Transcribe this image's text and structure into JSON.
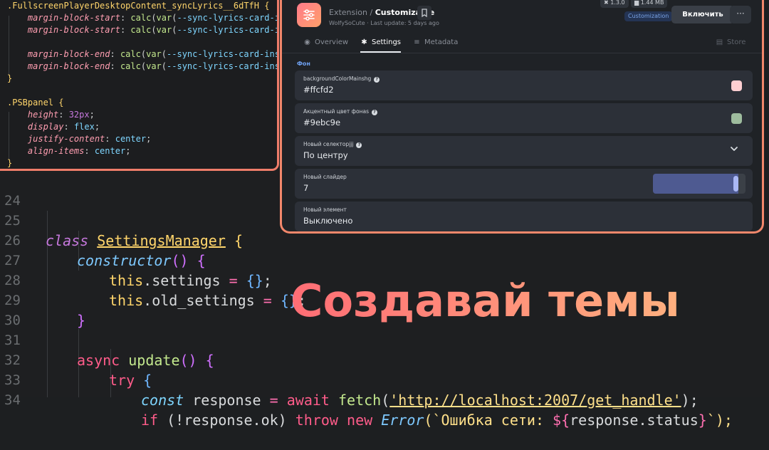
{
  "small_editor": {
    "lines": [
      ".FullscreenPlayerDesktopContent_syncLyrics__6dTfH {",
      "    margin-block-start: calc(var(--sync-lyrics-card-inse",
      "    margin-block-start: calc(var(--sync-lyrics-card-inse",
      "",
      "    margin-block-end: calc(var(--sync-lyrics-card-inset-",
      "    margin-block-end: calc(var(--sync-lyrics-card-inset-",
      "}",
      "",
      ".PSBpanel {",
      "    height: 32px;",
      "    display: flex;",
      "    justify-content: center;",
      "    align-items: center;",
      "}"
    ]
  },
  "big_editor": {
    "line_numbers": [
      "24",
      "25",
      "26",
      "27",
      "28",
      "29",
      "30",
      "31",
      "32",
      "33",
      "34"
    ],
    "code": {
      "l25_kw": "class",
      "l25_name": "SettingsManager",
      "l25_brace": "{",
      "l26_fn": "constructor",
      "l26_paren": "()",
      "l26_brace": "{",
      "l27_this": "this",
      "l27_prop": ".settings",
      "l27_eq": "=",
      "l27_obj": "{}",
      "l27_semi": ";",
      "l28_this": "this",
      "l28_prop": ".old_settings",
      "l28_eq": "=",
      "l28_obj": "{}",
      "l28_semi": ";",
      "l29_brace": "}",
      "l31_kw": "async",
      "l31_fn": "update",
      "l31_paren": "()",
      "l31_brace": "{",
      "l32_kw": "try",
      "l32_brace": "{",
      "l33_kw": "const",
      "l33_var": "response",
      "l33_eq": "=",
      "l33_await": "await",
      "l33_fn": "fetch",
      "l33_open": "(",
      "l33_str": "'http://localhost:2007/get_handle'",
      "l33_close": ");",
      "l34_if": "if",
      "l34_cond": "(!response.ok)",
      "l34_throw": "throw",
      "l34_new": "new",
      "l34_cls": "Error",
      "l34_tpl_a": "(`Ошибка сети: ",
      "l34_tpl_b": "${",
      "l34_tpl_c": "response.status",
      "l34_tpl_d": "}",
      "l34_tpl_e": "`);"
    }
  },
  "extension": {
    "kind": "Extension",
    "separator": " / ",
    "name": "Customizable",
    "author": "WolfySoCute",
    "meta_sep": " · ",
    "last_update": "Last update: 5 days ago",
    "version": "1.3.0",
    "size": "1.44 MB",
    "category": "Customization",
    "install_label": "Включить",
    "more_label": "···"
  },
  "tabs": [
    {
      "label": "Overview",
      "icon": "compass-icon"
    },
    {
      "label": "Settings",
      "icon": "gear-icon"
    },
    {
      "label": "Metadata",
      "icon": "document-icon"
    },
    {
      "label": "Store",
      "icon": "store-icon"
    }
  ],
  "settings": {
    "section_label": "Фон",
    "rows": [
      {
        "label": "backgroundColorMainshg",
        "value": "#ffcfd2",
        "swatch": "#ffcfd2",
        "has_help": true
      },
      {
        "label": "Акцентный цвет фонаs",
        "value": "#9ebc9e",
        "swatch": "#9ebc9e",
        "has_help": true
      },
      {
        "label": "Новый селекторjjj",
        "value": "По центру",
        "has_help": true
      },
      {
        "label": "Новый слайдер",
        "value": "7",
        "slider_fraction": 0.92
      },
      {
        "label": "Новый элемент",
        "value": "Выключено"
      }
    ]
  },
  "headline": "Создавай темы",
  "colors": {
    "accent_border": "#f2876b",
    "headline_start": "#ff6d75",
    "headline_end": "#ffb07f",
    "category_badge": "#79a4e8"
  }
}
